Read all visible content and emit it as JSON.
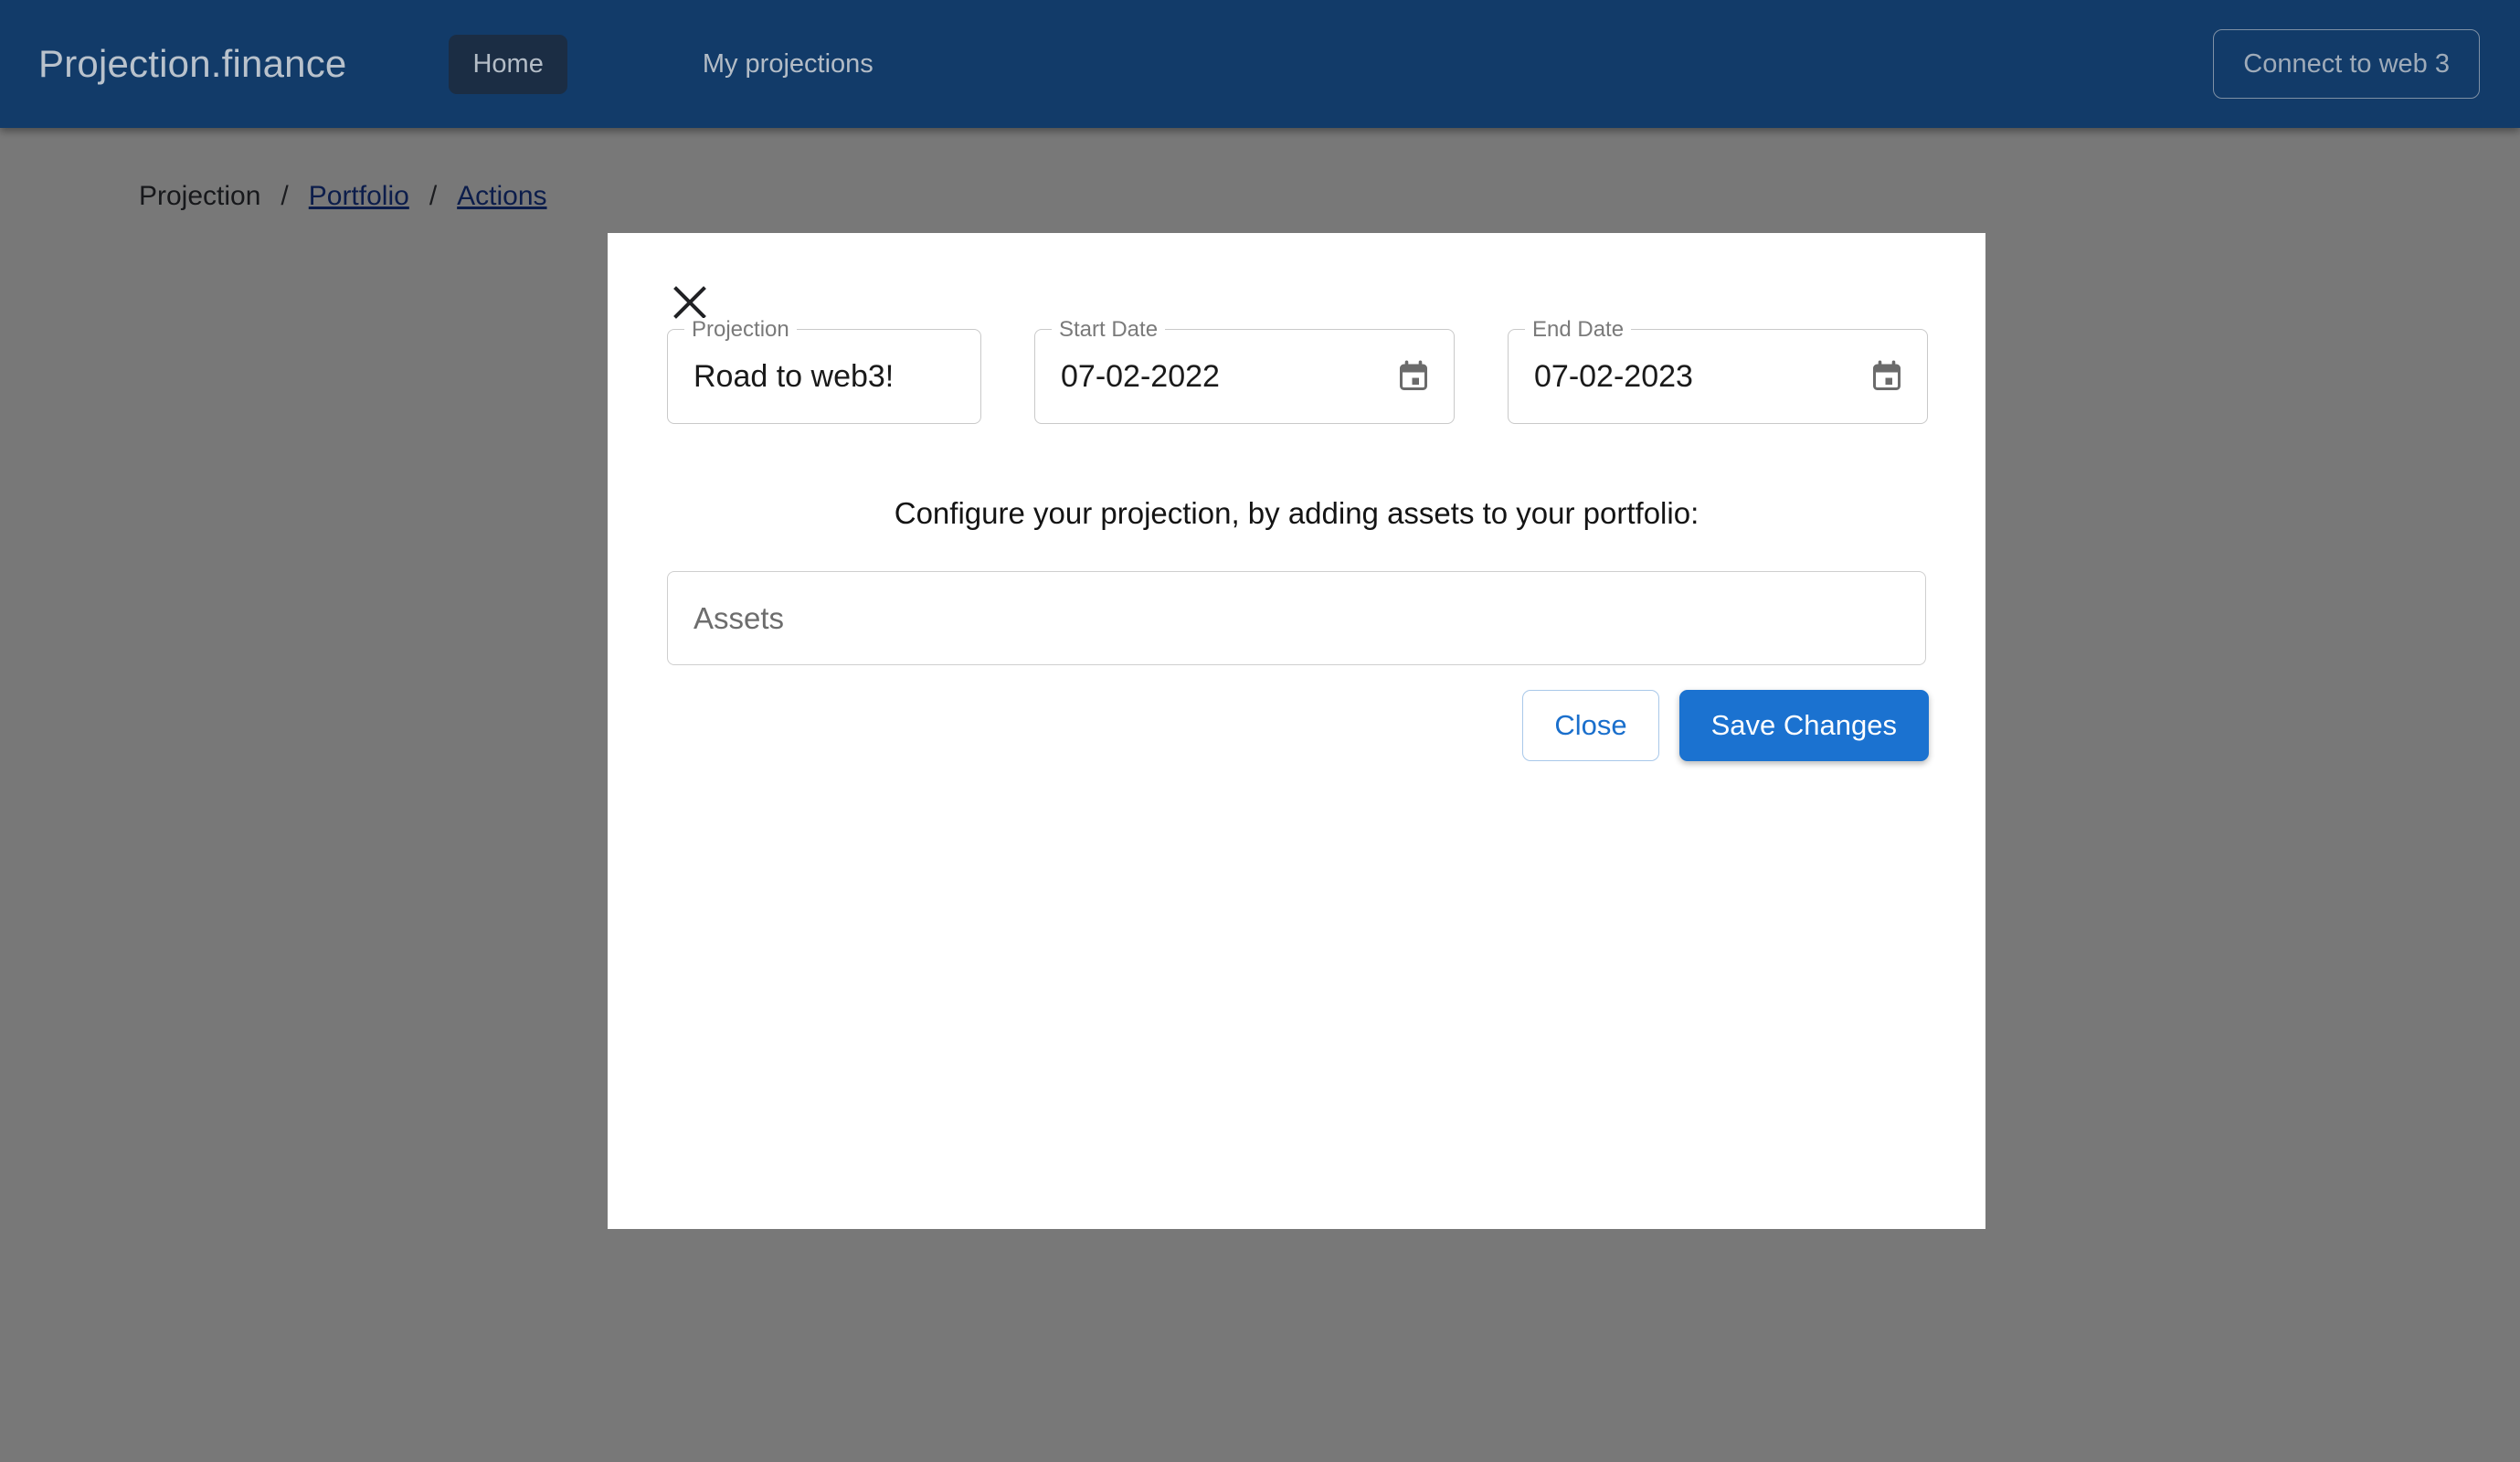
{
  "navbar": {
    "brand": "Projection.finance",
    "links": [
      {
        "label": "Home",
        "active": true
      },
      {
        "label": "My projections",
        "active": false
      }
    ],
    "connect_button": "Connect to web 3",
    "background_color": "#123b69",
    "active_pill_color": "#1b2d44"
  },
  "breadcrumb": {
    "current": "Projection",
    "separator": "/",
    "links": [
      {
        "label": "Portfolio"
      },
      {
        "label": "Actions"
      }
    ],
    "link_color": "#1b3fa0"
  },
  "modal": {
    "close_icon": "close-icon",
    "fields": {
      "projection": {
        "label": "Projection",
        "value": "Road to web3!"
      },
      "start_date": {
        "label": "Start Date",
        "value": "07-02-2022",
        "adornment_icon": "calendar-icon"
      },
      "end_date": {
        "label": "End Date",
        "value": "07-02-2023",
        "adornment_icon": "calendar-icon"
      }
    },
    "instruction": "Configure your projection, by adding assets to your portfolio:",
    "assets_input": {
      "placeholder": "Assets",
      "value": ""
    },
    "buttons": {
      "close": "Close",
      "save": "Save Changes"
    },
    "accent_color": "#1b72d0"
  }
}
